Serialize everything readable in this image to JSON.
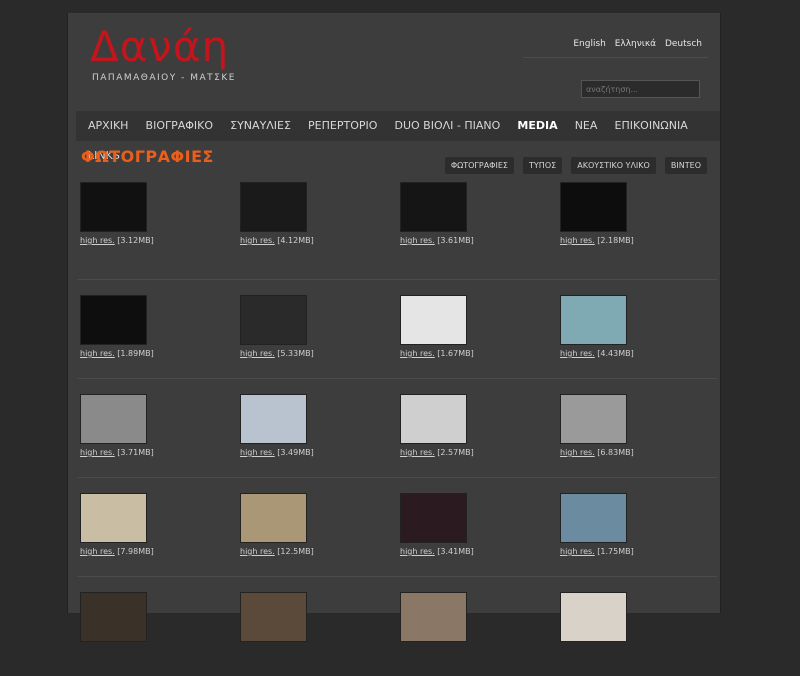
{
  "logo": {
    "title": "Δανάη",
    "subtitle": "ΠΑΠΑΜΑΘΑΙΟΥ - ΜΑΤΣΚΕ"
  },
  "languages": [
    "English",
    "Ελληνικά",
    "Deutsch"
  ],
  "search": {
    "placeholder": "αναζήτηση..."
  },
  "nav": [
    {
      "label": "ΑΡΧΙΚΗ",
      "active": false
    },
    {
      "label": "ΒΙΟΓΡΑΦΙΚΟ",
      "active": false
    },
    {
      "label": "ΣΥΝΑΥΛΙΕΣ",
      "active": false
    },
    {
      "label": "ΡΕΠΕΡΤΟΡΙΟ",
      "active": false
    },
    {
      "label": "DUO ΒΙΟΛΙ - ΠΙΑΝΟ",
      "active": false
    },
    {
      "label": "MEDIA",
      "active": true
    },
    {
      "label": "ΝΕΑ",
      "active": false
    },
    {
      "label": "ΕΠΙΚΟΙΝΩΝΙΑ",
      "active": false
    },
    {
      "label": "LINKS",
      "active": false
    }
  ],
  "section": {
    "title": "ΦΩΤΟΓΡΑΦΙΕΣ"
  },
  "subtabs": [
    "ΦΩΤΟΓΡΑΦΙΕΣ",
    "ΤΥΠΟΣ",
    "ΑΚΟΥΣΤΙΚΟ ΥΛΙΚΟ",
    "ΒΙΝΤΕΟ"
  ],
  "photos": [
    [
      {
        "link": "high res.",
        "size": "[3.12MB]",
        "bg": "#111111"
      },
      {
        "link": "high res.",
        "size": "[4.12MB]",
        "bg": "#1a1a1a"
      },
      {
        "link": "high res.",
        "size": "[3.61MB]",
        "bg": "#151515"
      },
      {
        "link": "high res.",
        "size": "[2.18MB]",
        "bg": "#0d0d0d"
      }
    ],
    [
      {
        "link": "high res.",
        "size": "[1.89MB]",
        "bg": "#0e0e0e"
      },
      {
        "link": "high res.",
        "size": "[5.33MB]",
        "bg": "#2a2a2a"
      },
      {
        "link": "high res.",
        "size": "[1.67MB]",
        "bg": "#e5e5e5"
      },
      {
        "link": "high res.",
        "size": "[4.43MB]",
        "bg": "#7fa9b3"
      }
    ],
    [
      {
        "link": "high res.",
        "size": "[3.71MB]",
        "bg": "#8a8a8a"
      },
      {
        "link": "high res.",
        "size": "[3.49MB]",
        "bg": "#b9c3cf"
      },
      {
        "link": "high res.",
        "size": "[2.57MB]",
        "bg": "#cfcfcf"
      },
      {
        "link": "high res.",
        "size": "[6.83MB]",
        "bg": "#9a9a9a"
      }
    ],
    [
      {
        "link": "high res.",
        "size": "[7.98MB]",
        "bg": "#c9bea3"
      },
      {
        "link": "high res.",
        "size": "[12.5MB]",
        "bg": "#a99776"
      },
      {
        "link": "high res.",
        "size": "[3.41MB]",
        "bg": "#2b1a20"
      },
      {
        "link": "high res.",
        "size": "[1.75MB]",
        "bg": "#6b8ca0"
      }
    ],
    [
      {
        "link": "",
        "size": "",
        "bg": "#3a3128"
      },
      {
        "link": "",
        "size": "",
        "bg": "#5b4a3a"
      },
      {
        "link": "",
        "size": "",
        "bg": "#8a7765"
      },
      {
        "link": "",
        "size": "",
        "bg": "#d8d2c9"
      }
    ]
  ],
  "colors": {
    "accent": "#e8601c",
    "logo": "#c3151c",
    "background": "#2a2a2a",
    "panel": "#3d3d3d",
    "nav": "#333333"
  }
}
